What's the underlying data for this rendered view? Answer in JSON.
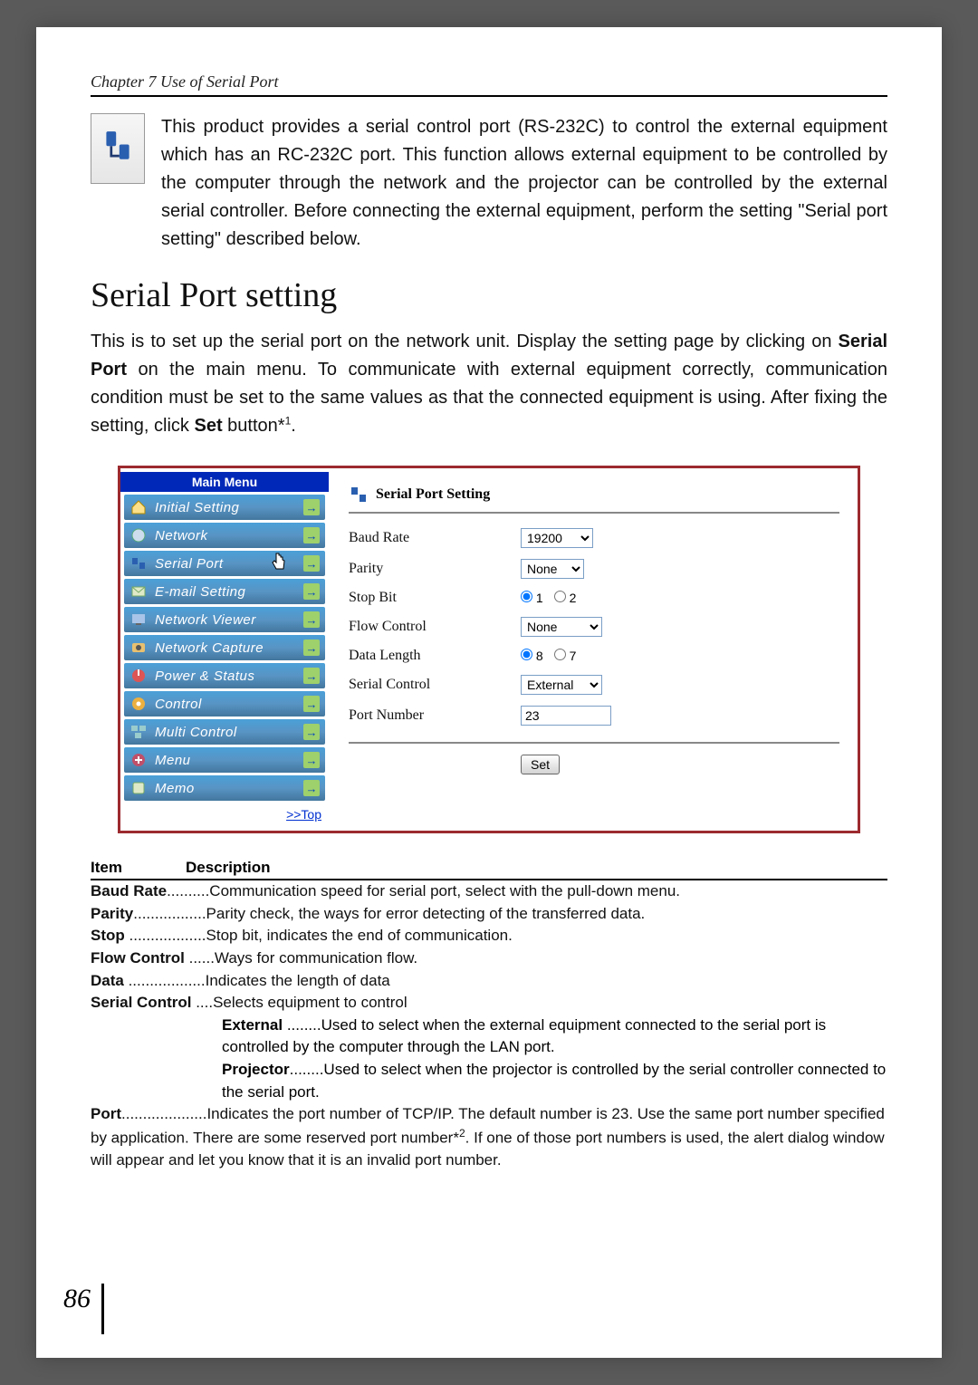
{
  "chapter_header": "Chapter 7 Use of Serial Port",
  "intro": "This product provides a serial control port (RS-232C) to control the external equipment which has an RC-232C port. This function allows external equipment to be controlled by the computer through the network and the projector can be controlled by the external serial controller. Before connecting the external equipment, perform the setting \"Serial port setting\" described below.",
  "section_title": "Serial Port setting",
  "section_body_parts": {
    "p1a": "This is to set up the serial port on the network unit. Display the setting page by clicking on ",
    "p1b": "Serial Port",
    "p1c": " on the main menu. To communicate with external equipment correctly, communication condition must be set to the same values as that the connected equipment is using. After fixing the setting, click ",
    "p1d": "Set",
    "p1e": " button*",
    "p1f": "1",
    "p1g": "."
  },
  "main_menu": {
    "title": "Main Menu",
    "items": [
      {
        "label": "Initial Setting",
        "icon": "home-icon"
      },
      {
        "label": "Network",
        "icon": "network-icon"
      },
      {
        "label": "Serial Port",
        "icon": "serial-icon",
        "cursor": true
      },
      {
        "label": "E-mail Setting",
        "icon": "email-icon"
      },
      {
        "label": "Network Viewer",
        "icon": "viewer-icon"
      },
      {
        "label": "Network Capture",
        "icon": "capture-icon"
      },
      {
        "label": "Power & Status",
        "icon": "power-icon"
      },
      {
        "label": "Control",
        "icon": "control-icon"
      },
      {
        "label": "Multi Control",
        "icon": "multi-icon"
      },
      {
        "label": "Menu",
        "icon": "menu-icon"
      },
      {
        "label": "Memo",
        "icon": "memo-icon"
      }
    ],
    "top_link": ">>Top"
  },
  "form": {
    "title": "Serial Port Setting",
    "baud_label": "Baud Rate",
    "baud_value": "19200",
    "parity_label": "Parity",
    "parity_value": "None",
    "stop_label": "Stop Bit",
    "stop_opts": [
      "1",
      "2"
    ],
    "stop_selected": "1",
    "flow_label": "Flow Control",
    "flow_value": "None",
    "data_label": "Data Length",
    "data_opts": [
      "8",
      "7"
    ],
    "data_selected": "8",
    "serialctrl_label": "Serial Control",
    "serialctrl_value": "External",
    "port_label": "Port Number",
    "port_value": "23",
    "set_button": "Set"
  },
  "desc_header": {
    "item": "Item",
    "desc": "Description"
  },
  "desc": {
    "baud": {
      "t": "Baud Rate",
      "d": "..........Communication speed for serial port, select with the pull-down menu."
    },
    "parity": {
      "t": "Parity",
      "d": ".................Parity check, the ways for error detecting of the transferred data."
    },
    "stop": {
      "t": "Stop",
      "d": " ..................Stop bit, indicates the end of communication."
    },
    "flow": {
      "t": "Flow Control",
      "d": " ......Ways for communication flow."
    },
    "data": {
      "t": "Data",
      "d": " ..................Indicates the length of data"
    },
    "sctrl": {
      "t": "Serial Control",
      "d": " ....Selects equipment to control"
    },
    "ext": {
      "t": "External",
      "d": " ........Used to select when the external equipment connected to the serial port is controlled by the computer through the LAN port."
    },
    "proj": {
      "t": "Projector",
      "d": "........Used to select when the projector is controlled by the serial controller connected to the serial port."
    },
    "port_a": {
      "t": "Port",
      "d": "....................Indicates the port number of TCP/IP. The default number is 23. Use the same port number specified by application. There are some reserved port number*"
    },
    "port_sup": "2",
    "port_b": ". If one of those port numbers is used, the alert dialog window will appear and let you know that it is an invalid port number."
  },
  "page_number": "86"
}
